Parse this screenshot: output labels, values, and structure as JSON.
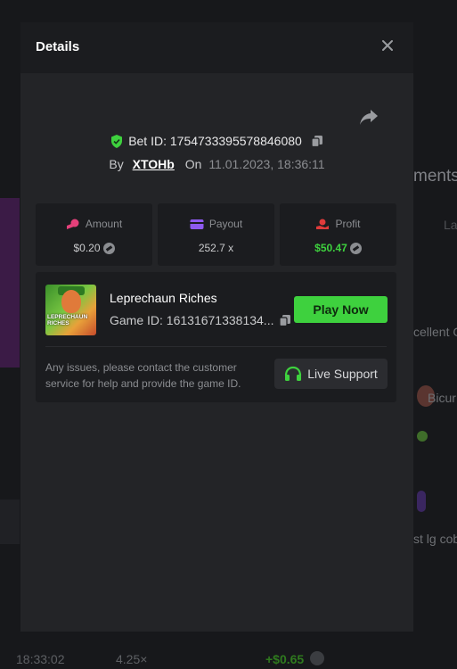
{
  "modal": {
    "title": "Details",
    "bet_id": "Bet ID: 1754733395578846080",
    "by_label": "By",
    "username": "XTOHb",
    "on_label": "On",
    "datetime": "11.01.2023, 18:36:11"
  },
  "stats": {
    "amount": {
      "label": "Amount",
      "value": "$0.20",
      "icon": "coins-icon"
    },
    "payout": {
      "label": "Payout",
      "value": "252.7 x",
      "icon": "card-icon"
    },
    "profit": {
      "label": "Profit",
      "value": "$50.47",
      "icon": "profit-icon"
    }
  },
  "game": {
    "name": "Leprechaun Riches",
    "id": "Game ID: 16131671338134...",
    "thumb_caption": "LEPRECHAUN RICHES",
    "play_label": "Play Now",
    "issues_text": "Any issues, please contact the customer service for help and provide the game ID.",
    "support_label": "Live Support"
  },
  "background": {
    "right_heading": "ments",
    "right_tab": "La",
    "right_text1": "cellent G",
    "right_text2": "Bicur",
    "right_text3": "st lg cob",
    "bottom_time": "18:33:02",
    "bottom_multiplier": "4.25×",
    "bottom_profit": "+$0.65"
  },
  "colors": {
    "accent_green": "#3ed13e",
    "amount_icon": "#e4407a",
    "payout_icon": "#8e5af0",
    "profit_icon": "#e03b3b"
  }
}
